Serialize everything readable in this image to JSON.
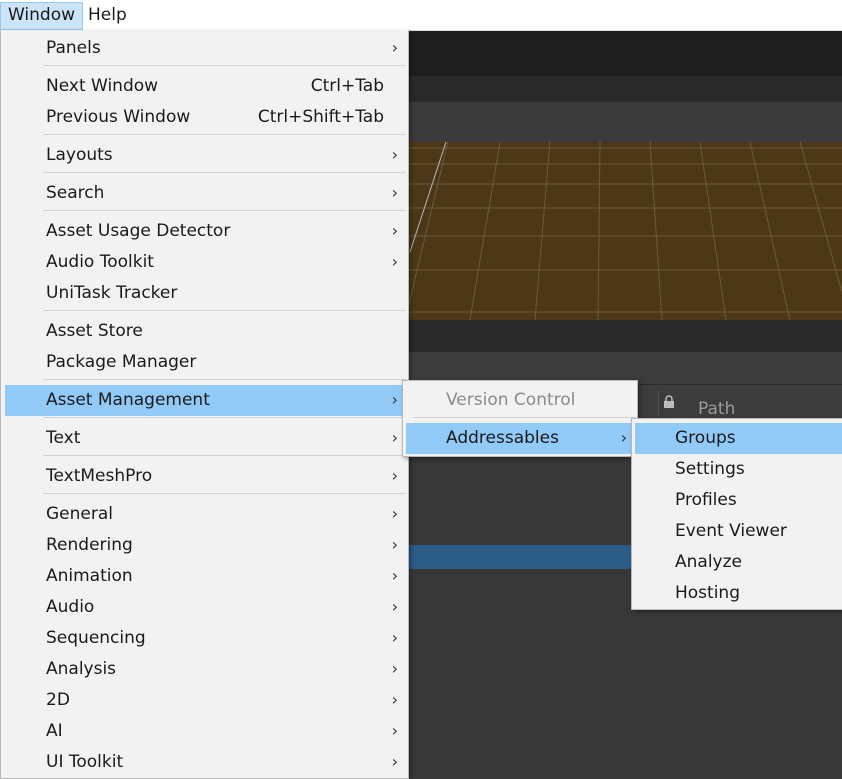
{
  "menubar": {
    "items": [
      {
        "label": "Window",
        "active": true
      },
      {
        "label": "Help",
        "active": false
      }
    ]
  },
  "window_menu": {
    "items": [
      {
        "label": "Panels",
        "submenu": true
      },
      {
        "label": "Next Window",
        "shortcut": "Ctrl+Tab"
      },
      {
        "label": "Previous Window",
        "shortcut": "Ctrl+Shift+Tab"
      },
      {
        "label": "Layouts",
        "submenu": true
      },
      {
        "label": "Search",
        "submenu": true
      },
      {
        "label": "Asset Usage Detector",
        "submenu": true
      },
      {
        "label": "Audio Toolkit",
        "submenu": true
      },
      {
        "label": "UniTask Tracker"
      },
      {
        "label": "Asset Store"
      },
      {
        "label": "Package Manager"
      },
      {
        "label": "Asset Management",
        "submenu": true,
        "selected": true
      },
      {
        "label": "Text",
        "submenu": true
      },
      {
        "label": "TextMeshPro",
        "submenu": true
      },
      {
        "label": "General",
        "submenu": true
      },
      {
        "label": "Rendering",
        "submenu": true
      },
      {
        "label": "Animation",
        "submenu": true
      },
      {
        "label": "Audio",
        "submenu": true
      },
      {
        "label": "Sequencing",
        "submenu": true
      },
      {
        "label": "Analysis",
        "submenu": true
      },
      {
        "label": "2D",
        "submenu": true
      },
      {
        "label": "AI",
        "submenu": true
      },
      {
        "label": "UI Toolkit",
        "submenu": true
      }
    ]
  },
  "asset_management_menu": {
    "items": [
      {
        "label": "Version Control",
        "disabled": true
      },
      {
        "label": "Addressables",
        "submenu": true,
        "selected": true
      }
    ]
  },
  "addressables_menu": {
    "items": [
      {
        "label": "Groups",
        "selected": true
      },
      {
        "label": "Settings"
      },
      {
        "label": "Profiles"
      },
      {
        "label": "Event Viewer"
      },
      {
        "label": "Analyze"
      },
      {
        "label": "Hosting"
      }
    ]
  },
  "editor": {
    "project_header": {
      "path_label": "Path"
    }
  },
  "icons": {
    "submenu_arrow": "chevron-right-icon",
    "path_icon": "lock-icon"
  }
}
